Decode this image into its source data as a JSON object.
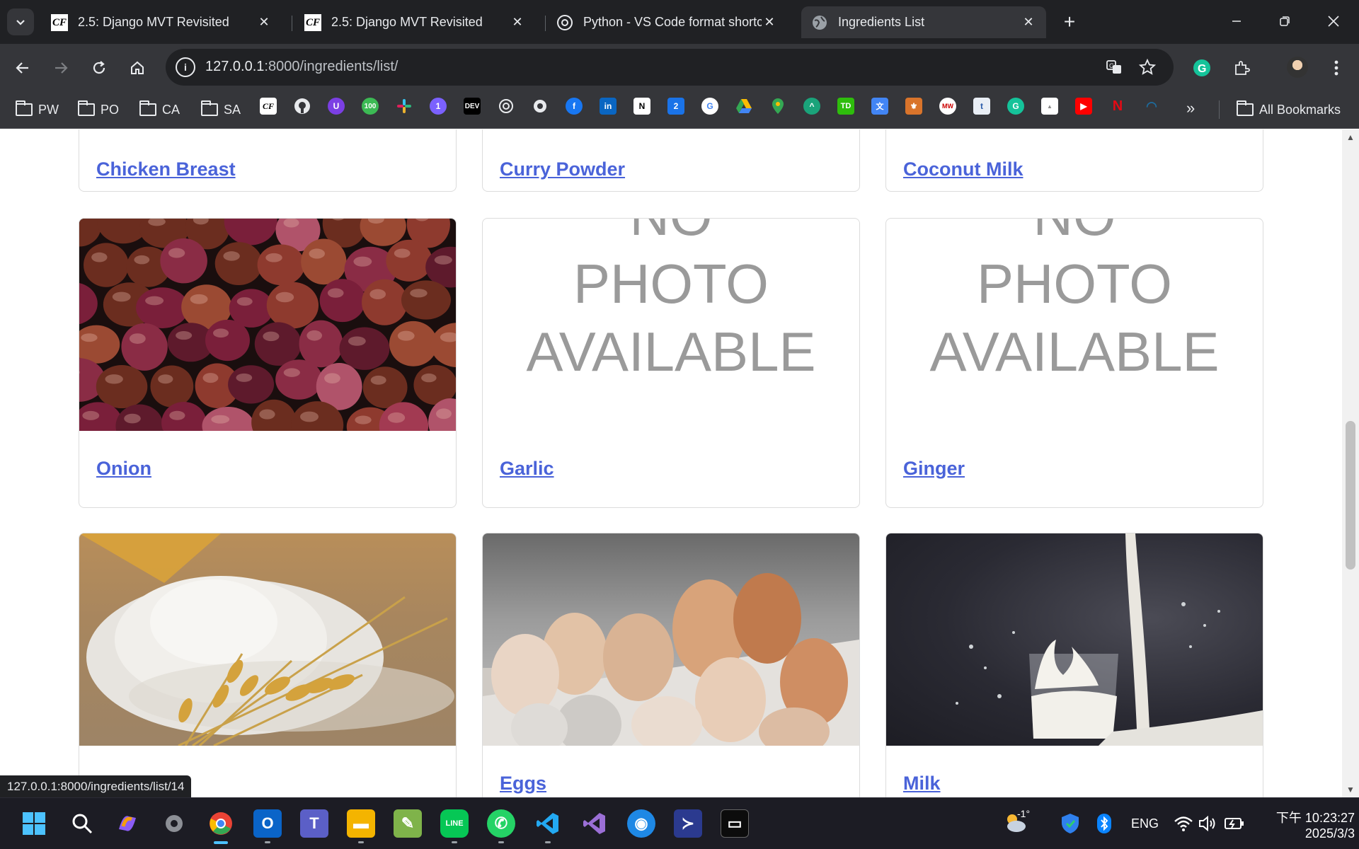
{
  "browser": {
    "tabs": [
      {
        "title": "2.5: Django MVT Revisited",
        "favicon": "careerfoundry-icon",
        "active": false
      },
      {
        "title": "2.5: Django MVT Revisited",
        "favicon": "careerfoundry-icon",
        "active": false
      },
      {
        "title": "Python - VS Code format shortc",
        "favicon": "chatgpt-icon",
        "active": false
      },
      {
        "title": "Ingredients List",
        "favicon": "globe-icon",
        "active": true
      }
    ],
    "url_host": "127.0.0.1",
    "url_path": ":8000/ingredients/list/",
    "bookmark_folders": [
      "PW",
      "PO",
      "CA",
      "SA"
    ],
    "all_bookmarks_label": "All Bookmarks",
    "status_url": "127.0.0.1:8000/ingredients/list/14"
  },
  "page": {
    "no_photo_text": [
      "NO",
      "PHOTO",
      "AVAILABLE"
    ],
    "ingredients": [
      {
        "name": "Chicken Breast",
        "photo": "none-visible"
      },
      {
        "name": "Curry Powder",
        "photo": "none-visible"
      },
      {
        "name": "Coconut Milk",
        "photo": "none-visible"
      },
      {
        "name": "Onion",
        "photo": "onion-photo"
      },
      {
        "name": "Garlic",
        "photo": "no-photo-placeholder"
      },
      {
        "name": "Ginger",
        "photo": "no-photo-placeholder"
      },
      {
        "name": "",
        "photo": "flour-photo"
      },
      {
        "name": "Eggs",
        "photo": "eggs-photo"
      },
      {
        "name": "Milk",
        "photo": "milk-photo"
      }
    ]
  },
  "taskbar": {
    "weather": "-1°",
    "language": "ENG",
    "time": "下午 10:23:27",
    "date": "2025/3/3"
  },
  "colors": {
    "link": "#4a63d9",
    "chrome_dark": "#202124",
    "chrome_mid": "#35363a"
  }
}
